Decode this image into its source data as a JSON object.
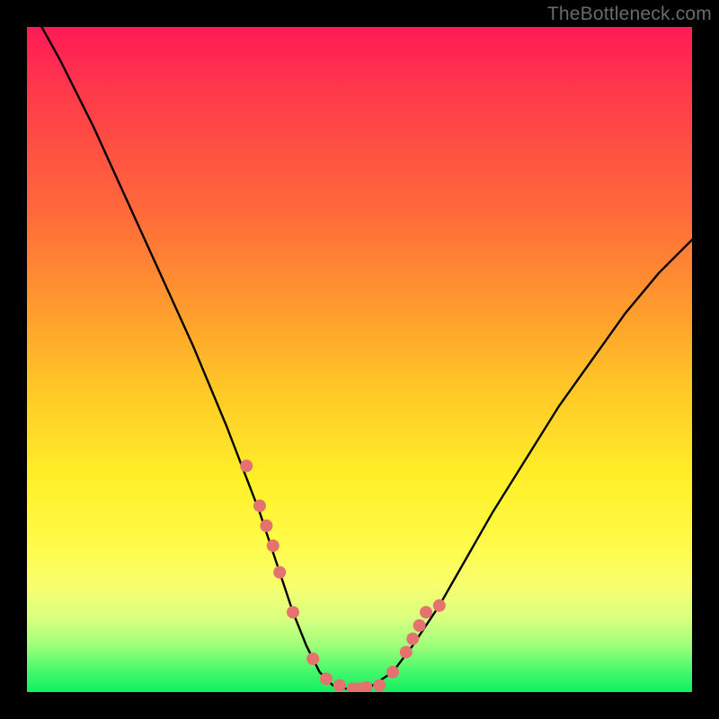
{
  "watermark": "TheBottleneck.com",
  "chart_data": {
    "type": "line",
    "title": "",
    "xlabel": "",
    "ylabel": "",
    "xlim": [
      0,
      100
    ],
    "ylim": [
      0,
      100
    ],
    "series": [
      {
        "name": "bottleneck-curve",
        "x": [
          0,
          5,
          10,
          15,
          20,
          25,
          30,
          35,
          38,
          40,
          42,
          44,
          46,
          48,
          50,
          52,
          55,
          58,
          62,
          66,
          70,
          75,
          80,
          85,
          90,
          95,
          100
        ],
        "values": [
          104,
          95,
          85,
          74,
          63,
          52,
          40,
          27,
          18,
          12,
          7,
          3,
          1,
          0.5,
          0.5,
          1,
          3,
          7,
          13,
          20,
          27,
          35,
          43,
          50,
          57,
          63,
          68
        ]
      }
    ],
    "markers": {
      "name": "highlight-dots",
      "color": "#e4736f",
      "x": [
        33,
        35,
        36,
        37,
        38,
        40,
        43,
        45,
        47,
        49,
        50,
        51,
        53,
        55,
        57,
        58,
        59,
        60,
        62
      ],
      "values": [
        34,
        28,
        25,
        22,
        18,
        12,
        5,
        2,
        1,
        0.5,
        0.5,
        0.7,
        1,
        3,
        6,
        8,
        10,
        12,
        13
      ]
    },
    "annotations": []
  }
}
